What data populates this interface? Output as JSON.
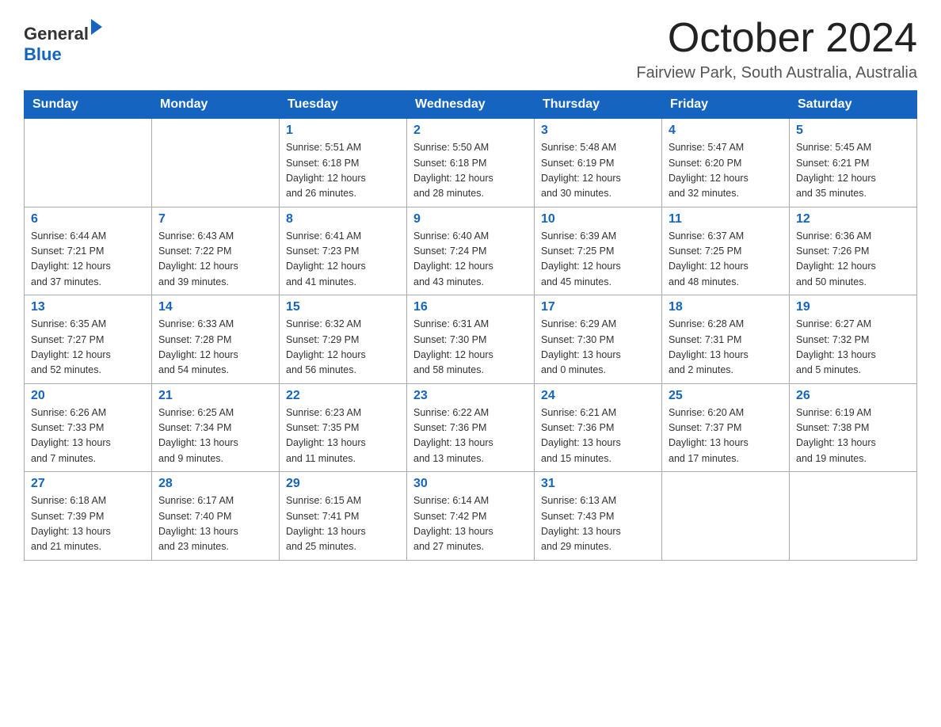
{
  "header": {
    "logo_general": "General",
    "logo_blue": "Blue",
    "month_title": "October 2024",
    "location": "Fairview Park, South Australia, Australia"
  },
  "days_of_week": [
    "Sunday",
    "Monday",
    "Tuesday",
    "Wednesday",
    "Thursday",
    "Friday",
    "Saturday"
  ],
  "weeks": [
    [
      {
        "day": "",
        "info": ""
      },
      {
        "day": "",
        "info": ""
      },
      {
        "day": "1",
        "info": "Sunrise: 5:51 AM\nSunset: 6:18 PM\nDaylight: 12 hours\nand 26 minutes."
      },
      {
        "day": "2",
        "info": "Sunrise: 5:50 AM\nSunset: 6:18 PM\nDaylight: 12 hours\nand 28 minutes."
      },
      {
        "day": "3",
        "info": "Sunrise: 5:48 AM\nSunset: 6:19 PM\nDaylight: 12 hours\nand 30 minutes."
      },
      {
        "day": "4",
        "info": "Sunrise: 5:47 AM\nSunset: 6:20 PM\nDaylight: 12 hours\nand 32 minutes."
      },
      {
        "day": "5",
        "info": "Sunrise: 5:45 AM\nSunset: 6:21 PM\nDaylight: 12 hours\nand 35 minutes."
      }
    ],
    [
      {
        "day": "6",
        "info": "Sunrise: 6:44 AM\nSunset: 7:21 PM\nDaylight: 12 hours\nand 37 minutes."
      },
      {
        "day": "7",
        "info": "Sunrise: 6:43 AM\nSunset: 7:22 PM\nDaylight: 12 hours\nand 39 minutes."
      },
      {
        "day": "8",
        "info": "Sunrise: 6:41 AM\nSunset: 7:23 PM\nDaylight: 12 hours\nand 41 minutes."
      },
      {
        "day": "9",
        "info": "Sunrise: 6:40 AM\nSunset: 7:24 PM\nDaylight: 12 hours\nand 43 minutes."
      },
      {
        "day": "10",
        "info": "Sunrise: 6:39 AM\nSunset: 7:25 PM\nDaylight: 12 hours\nand 45 minutes."
      },
      {
        "day": "11",
        "info": "Sunrise: 6:37 AM\nSunset: 7:25 PM\nDaylight: 12 hours\nand 48 minutes."
      },
      {
        "day": "12",
        "info": "Sunrise: 6:36 AM\nSunset: 7:26 PM\nDaylight: 12 hours\nand 50 minutes."
      }
    ],
    [
      {
        "day": "13",
        "info": "Sunrise: 6:35 AM\nSunset: 7:27 PM\nDaylight: 12 hours\nand 52 minutes."
      },
      {
        "day": "14",
        "info": "Sunrise: 6:33 AM\nSunset: 7:28 PM\nDaylight: 12 hours\nand 54 minutes."
      },
      {
        "day": "15",
        "info": "Sunrise: 6:32 AM\nSunset: 7:29 PM\nDaylight: 12 hours\nand 56 minutes."
      },
      {
        "day": "16",
        "info": "Sunrise: 6:31 AM\nSunset: 7:30 PM\nDaylight: 12 hours\nand 58 minutes."
      },
      {
        "day": "17",
        "info": "Sunrise: 6:29 AM\nSunset: 7:30 PM\nDaylight: 13 hours\nand 0 minutes."
      },
      {
        "day": "18",
        "info": "Sunrise: 6:28 AM\nSunset: 7:31 PM\nDaylight: 13 hours\nand 2 minutes."
      },
      {
        "day": "19",
        "info": "Sunrise: 6:27 AM\nSunset: 7:32 PM\nDaylight: 13 hours\nand 5 minutes."
      }
    ],
    [
      {
        "day": "20",
        "info": "Sunrise: 6:26 AM\nSunset: 7:33 PM\nDaylight: 13 hours\nand 7 minutes."
      },
      {
        "day": "21",
        "info": "Sunrise: 6:25 AM\nSunset: 7:34 PM\nDaylight: 13 hours\nand 9 minutes."
      },
      {
        "day": "22",
        "info": "Sunrise: 6:23 AM\nSunset: 7:35 PM\nDaylight: 13 hours\nand 11 minutes."
      },
      {
        "day": "23",
        "info": "Sunrise: 6:22 AM\nSunset: 7:36 PM\nDaylight: 13 hours\nand 13 minutes."
      },
      {
        "day": "24",
        "info": "Sunrise: 6:21 AM\nSunset: 7:36 PM\nDaylight: 13 hours\nand 15 minutes."
      },
      {
        "day": "25",
        "info": "Sunrise: 6:20 AM\nSunset: 7:37 PM\nDaylight: 13 hours\nand 17 minutes."
      },
      {
        "day": "26",
        "info": "Sunrise: 6:19 AM\nSunset: 7:38 PM\nDaylight: 13 hours\nand 19 minutes."
      }
    ],
    [
      {
        "day": "27",
        "info": "Sunrise: 6:18 AM\nSunset: 7:39 PM\nDaylight: 13 hours\nand 21 minutes."
      },
      {
        "day": "28",
        "info": "Sunrise: 6:17 AM\nSunset: 7:40 PM\nDaylight: 13 hours\nand 23 minutes."
      },
      {
        "day": "29",
        "info": "Sunrise: 6:15 AM\nSunset: 7:41 PM\nDaylight: 13 hours\nand 25 minutes."
      },
      {
        "day": "30",
        "info": "Sunrise: 6:14 AM\nSunset: 7:42 PM\nDaylight: 13 hours\nand 27 minutes."
      },
      {
        "day": "31",
        "info": "Sunrise: 6:13 AM\nSunset: 7:43 PM\nDaylight: 13 hours\nand 29 minutes."
      },
      {
        "day": "",
        "info": ""
      },
      {
        "day": "",
        "info": ""
      }
    ]
  ]
}
